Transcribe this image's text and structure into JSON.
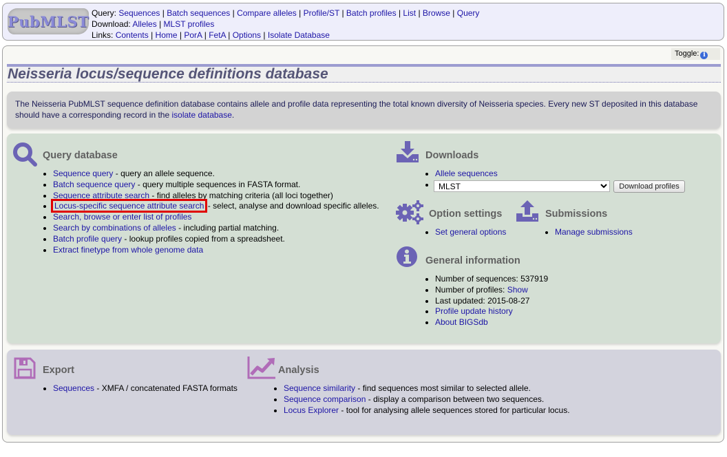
{
  "header": {
    "logo_text": "PubMLST",
    "query_label": "Query:",
    "query_links": [
      "Sequences",
      "Batch sequences",
      "Compare alleles",
      "Profile/ST",
      "Batch profiles",
      "List",
      "Browse",
      "Query"
    ],
    "download_label": "Download:",
    "download_links": [
      "Alleles",
      "MLST profiles"
    ],
    "links_label": "Links:",
    "links": [
      "Contents",
      "Home",
      "PorA",
      "FetA",
      "Options",
      "Isolate Database"
    ]
  },
  "toggle": {
    "label": "Toggle:",
    "icon": "info-icon"
  },
  "page_title": "Neisseria locus/sequence definitions database",
  "intro": {
    "text_before": "The Neisseria PubMLST sequence definition database contains allele and profile data representing the total known diversity of Neisseria species. Every new ST deposited in this database should have a corresponding record in the ",
    "link": "isolate database",
    "text_after": "."
  },
  "query_database": {
    "title": "Query database",
    "icon": "magnifier-icon",
    "items": [
      {
        "link": "Sequence query",
        "desc": " - query an allele sequence."
      },
      {
        "link": "Batch sequence query",
        "desc": " - query multiple sequences in FASTA format."
      },
      {
        "link": "Sequence attribute search",
        "desc": " - find alleles by matching criteria (all loci together)"
      },
      {
        "link": "Locus-specific sequence attribute search",
        "desc": " - select, analyse and download specific alleles.",
        "highlighted": true
      },
      {
        "link": "Search, browse or enter list of profiles",
        "desc": ""
      },
      {
        "link": "Search by combinations of alleles",
        "desc": " - including partial matching."
      },
      {
        "link": "Batch profile query",
        "desc": " - lookup profiles copied from a spreadsheet."
      },
      {
        "link": "Extract finetype from whole genome data",
        "desc": ""
      }
    ]
  },
  "downloads": {
    "title": "Downloads",
    "icon": "download-icon",
    "allele_link": "Allele sequences",
    "scheme_select": {
      "selected": "MLST",
      "options": [
        "MLST"
      ]
    },
    "download_button": "Download profiles"
  },
  "option_settings": {
    "title": "Option settings",
    "icon": "gears-icon",
    "items": [
      "Set general options"
    ]
  },
  "submissions": {
    "title": "Submissions",
    "icon": "upload-icon",
    "items": [
      "Manage submissions"
    ]
  },
  "general_information": {
    "title": "General information",
    "icon": "info-icon",
    "num_sequences_label": "Number of sequences: ",
    "num_sequences": "537919",
    "num_profiles_label": "Number of profiles: ",
    "num_profiles_link": "Show",
    "last_updated_label": "Last updated: ",
    "last_updated": "2015-08-27",
    "links": [
      "Profile update history",
      "About BIGSdb"
    ]
  },
  "export": {
    "title": "Export",
    "icon": "floppy-disk-icon",
    "items": [
      {
        "link": "Sequences",
        "desc": " - XMFA / concatenated FASTA formats"
      }
    ]
  },
  "analysis": {
    "title": "Analysis",
    "icon": "trend-chart-icon",
    "items": [
      {
        "link": "Sequence similarity",
        "desc": " - find sequences most similar to selected allele."
      },
      {
        "link": "Sequence comparison",
        "desc": " - display a comparison between two sequences."
      },
      {
        "link": "Locus Explorer",
        "desc": " - tool for analysing allele sequences stored for particular locus."
      }
    ]
  },
  "colors": {
    "link": "#1c14a6",
    "icon_purple": "#6b63b5",
    "icon_magenta": "#b06cb8",
    "highlight_red": "#e00000"
  }
}
